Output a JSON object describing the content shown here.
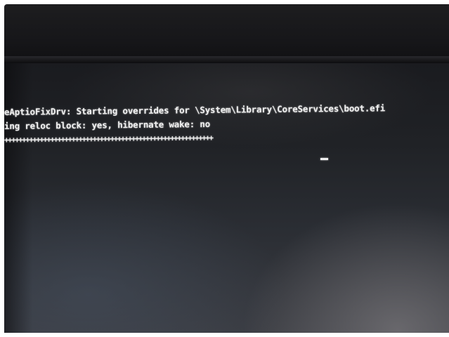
{
  "console": {
    "lines": [
      "eAptioFixDrv: Starting overrides for \\System\\Library\\CoreServices\\boot.efi",
      "ing reloc block: yes, hibernate wake: no",
      "+++++++++++++++++++++++++++++++++++++++++++++++++++++++++++"
    ],
    "cursor": "_"
  },
  "colors": {
    "console_text": "#f2f2f2",
    "screen_background": "#1e2024",
    "bezel": "#17171a"
  }
}
